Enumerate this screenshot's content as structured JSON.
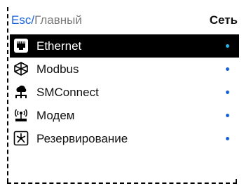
{
  "header": {
    "breadcrumb_root": "Esc",
    "breadcrumb_separator": "/",
    "breadcrumb_current": "Главный",
    "section_title": "Сеть"
  },
  "colors": {
    "accent": "#1b62d9",
    "selected_background": "#000000",
    "selected_dot": "#23b7ea"
  },
  "menu": {
    "selected_index": 0,
    "items": [
      {
        "label": "Ethernet",
        "icon": "ethernet-port-icon",
        "enabled": true
      },
      {
        "label": "Modbus",
        "icon": "network-cube-icon",
        "enabled": true
      },
      {
        "label": "SMConnect",
        "icon": "cloud-network-icon",
        "enabled": true
      },
      {
        "label": "Модем",
        "icon": "wireless-modem-icon",
        "enabled": true
      },
      {
        "label": "Резервирование",
        "icon": "redundancy-icon",
        "enabled": true
      }
    ]
  }
}
